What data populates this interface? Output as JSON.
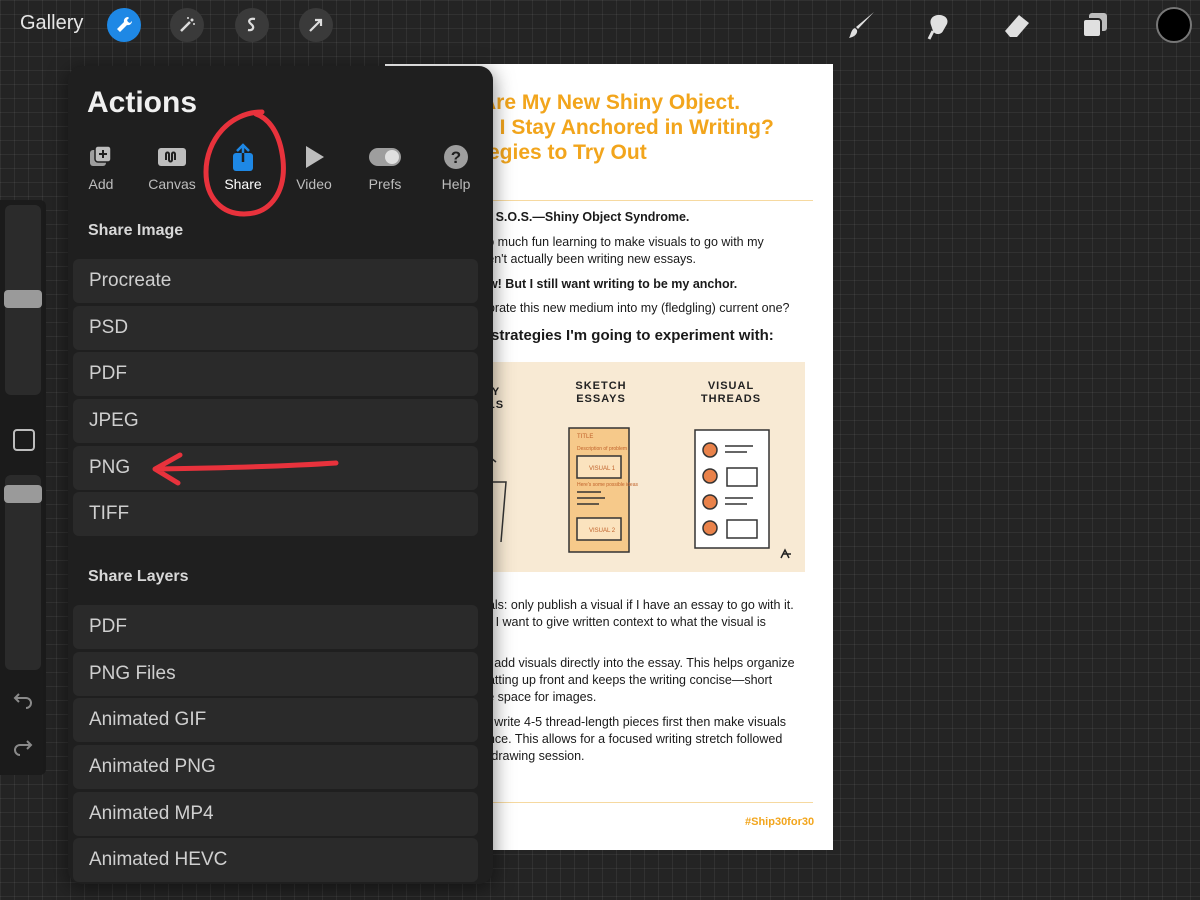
{
  "topbar": {
    "gallery_label": "Gallery",
    "tools": [
      {
        "icon": "wrench-icon",
        "active": true
      },
      {
        "icon": "magic-wand-icon",
        "active": false
      },
      {
        "icon": "selection-icon",
        "active": false
      },
      {
        "icon": "transform-arrow-icon",
        "active": false
      }
    ],
    "right_tools": [
      "brush-icon",
      "smudge-icon",
      "eraser-icon",
      "layers-icon"
    ],
    "current_color": "#000000",
    "accent_color": "#1e88e5"
  },
  "actions_panel": {
    "title": "Actions",
    "tabs": [
      {
        "label": "Add",
        "icon": "add-image-icon"
      },
      {
        "label": "Canvas",
        "icon": "canvas-icon"
      },
      {
        "label": "Share",
        "icon": "share-icon",
        "active": true
      },
      {
        "label": "Video",
        "icon": "play-icon"
      },
      {
        "label": "Prefs",
        "icon": "toggle-icon"
      },
      {
        "label": "Help",
        "icon": "question-icon"
      }
    ],
    "share_image_title": "Share Image",
    "share_image_items": [
      "Procreate",
      "PSD",
      "PDF",
      "JPEG",
      "PNG",
      "TIFF"
    ],
    "share_layers_title": "Share Layers",
    "share_layers_items": [
      "PDF",
      "PNG Files",
      "Animated GIF",
      "Animated PNG",
      "Animated MP4",
      "Animated HEVC"
    ]
  },
  "annotation": {
    "circle_color": "#e8323c",
    "arrow_target": "PNG"
  },
  "document": {
    "title_lines": [
      "Are My New Shiny Object.",
      "n I Stay Anchored in Writing?",
      "tegies to Try Out"
    ],
    "title_color": "#f2a51c",
    "body_lines": [
      {
        "text": "m S.O.S.—Shiny Object Syndrome.",
        "bold": true
      },
      {
        "text": " so much fun learning to make visuals to go with my",
        "bold": false
      },
      {
        "text": "ven't actually been writing new essays.",
        "bold": false
      },
      {
        "text": "aw! But I still want writing to be my anchor.",
        "bold": true
      },
      {
        "text": "porate this new medium into my (fledgling) current one?",
        "bold": false
      }
    ],
    "strategies_heading": "strategies I'm going to experiment with:",
    "illustration_labels": [
      "Y\nLS",
      "SKETCH\nESSAYS",
      "VISUAL\nTHREADS"
    ],
    "illustration_sublabels": [
      "TITLE",
      "Description of problem",
      "VISUAL 1",
      "Here's some possible ideas",
      "VISUAL 2"
    ],
    "bottom_lines": [
      {
        "text": "uals: only publish a visual if I have an essay to go with it.",
        "bold": false
      },
      {
        "text": "rt, I want to give written context to what the visual is",
        "bold": false
      },
      {
        "text": "s: add visuals directly into the essay. This helps organize",
        "bold": false
      },
      {
        "text": "hatting up front and keeps the writing concise—short",
        "bold": false
      },
      {
        "text": "ve space for images.",
        "bold": false
      },
      {
        "text": "s: write 4-5 thread-length pieces first then make visuals",
        "bold": false
      },
      {
        "text": "once. This allows for a focused writing stretch followed",
        "bold": false
      },
      {
        "text": "d drawing session.",
        "bold": false
      }
    ],
    "hashtag": "#Ship30for30"
  }
}
